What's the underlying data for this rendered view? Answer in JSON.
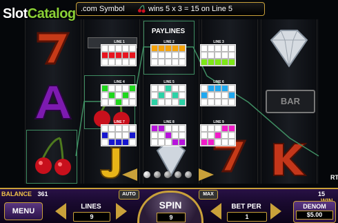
{
  "header": {
    "text_a": ".com Symbol",
    "symbol_icon": "cherry-icon",
    "text_b": "wins 5 x 3 = 15 on Line 5"
  },
  "logo": {
    "part1": "Slot",
    "part2": "Catalog"
  },
  "paylines_panel": {
    "title": "PAYLINES",
    "lines": [
      {
        "label": "LINE 1",
        "color": "#e8141f",
        "rows": [
          1,
          1,
          1,
          1,
          1
        ]
      },
      {
        "label": "LINE 2",
        "color": "#f5a20a",
        "rows": [
          0,
          0,
          0,
          0,
          0
        ]
      },
      {
        "label": "LINE 3",
        "color": "#7ee818",
        "rows": [
          2,
          2,
          2,
          2,
          2
        ]
      },
      {
        "label": "LINE 4",
        "color": "#1fd81c",
        "rows": [
          0,
          1,
          2,
          1,
          0
        ]
      },
      {
        "label": "LINE 5",
        "color": "#2cd2a6",
        "rows": [
          2,
          1,
          0,
          1,
          2
        ]
      },
      {
        "label": "LINE 6",
        "color": "#1fa8f0",
        "rows": [
          1,
          0,
          0,
          0,
          1
        ]
      },
      {
        "label": "LINE 7",
        "color": "#1616d0",
        "rows": [
          1,
          2,
          2,
          2,
          1
        ]
      },
      {
        "label": "LINE 8",
        "color": "#b714dc",
        "rows": [
          0,
          0,
          1,
          2,
          2
        ]
      },
      {
        "label": "LINE 9",
        "color": "#f01cc8",
        "rows": [
          2,
          2,
          1,
          0,
          0
        ]
      }
    ]
  },
  "pager": {
    "pages": 5,
    "active": 0
  },
  "footer": {
    "balance_label": "BALANCE",
    "balance_value": "361",
    "win_value": "15",
    "win_label": "WIN",
    "menu_label": "MENU",
    "lines_label": "LINES",
    "lines_value": "9",
    "auto_label": "AUTO",
    "spin_label": "SPIN",
    "spin_lines": "9",
    "max_label": "MAX",
    "bet_label": "BET PER",
    "bet_value": "1",
    "denom_label": "DENOM",
    "denom_value": "$5.00",
    "side_text": "RT"
  }
}
